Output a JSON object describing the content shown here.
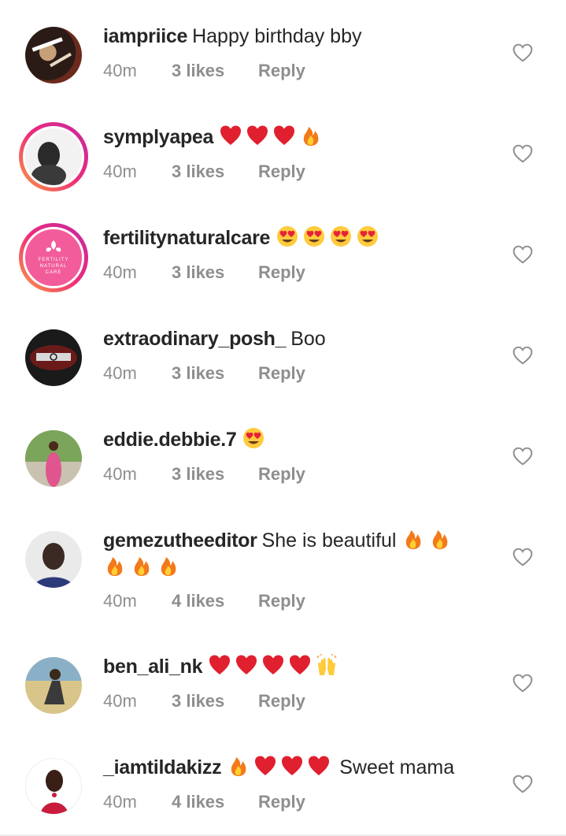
{
  "comments": [
    {
      "username": "iampriice",
      "text": "Happy birthday bby",
      "emojis": [],
      "time": "40m",
      "likes": "3 likes",
      "reply": "Reply",
      "story_ring": false,
      "avatar_colors": [
        "#6b2a1d",
        "#2b1b17",
        "#c7a07a"
      ]
    },
    {
      "username": "symplyapea",
      "text": "",
      "emojis": [
        "red-heart",
        "red-heart",
        "red-heart",
        "fire"
      ],
      "time": "40m",
      "likes": "3 likes",
      "reply": "Reply",
      "story_ring": true,
      "avatar_colors": [
        "#f2f2f2",
        "#2a2a2a",
        "#bdbdbd"
      ]
    },
    {
      "username": "fertilitynaturalcare",
      "text": "",
      "emojis": [
        "heart-eyes",
        "heart-eyes",
        "heart-eyes",
        "heart-eyes"
      ],
      "time": "40m",
      "likes": "3 likes",
      "reply": "Reply",
      "story_ring": true,
      "avatar_colors": [
        "#f25c9a",
        "#ffffff",
        "#f7a9c8"
      ],
      "avatar_logo_text": [
        "FERTILITY",
        "NATURAL",
        "CARE"
      ]
    },
    {
      "username": "extraodinary_posh_",
      "text": "Boo",
      "emojis": [],
      "time": "40m",
      "likes": "3 likes",
      "reply": "Reply",
      "story_ring": false,
      "avatar_colors": [
        "#1a1a1a",
        "#6b1a1a",
        "#d9d9d9"
      ]
    },
    {
      "username": "eddie.debbie.7",
      "text": "",
      "emojis": [
        "heart-eyes"
      ],
      "time": "40m",
      "likes": "3 likes",
      "reply": "Reply",
      "story_ring": false,
      "avatar_colors": [
        "#7ba55a",
        "#e0558d",
        "#c9c2b0"
      ]
    },
    {
      "username": "gemezutheeditor",
      "text": "She is beautiful",
      "emojis": [
        "fire",
        "fire"
      ],
      "emojis_line2": [
        "fire",
        "fire",
        "fire"
      ],
      "time": "40m",
      "likes": "4 likes",
      "reply": "Reply",
      "story_ring": false,
      "avatar_colors": [
        "#eaeaea",
        "#3b2a24",
        "#2d3a7a"
      ]
    },
    {
      "username": "ben_ali_nk",
      "text": "",
      "emojis": [
        "red-heart",
        "red-heart",
        "red-heart",
        "red-heart",
        "raising-hands"
      ],
      "time": "40m",
      "likes": "3 likes",
      "reply": "Reply",
      "story_ring": false,
      "avatar_colors": [
        "#d9c58a",
        "#3a3a3a",
        "#8ab0c7"
      ]
    },
    {
      "username": "_iamtildakizz",
      "text": "Sweet mama",
      "emojis": [
        "fire",
        "red-heart",
        "red-heart",
        "red-heart"
      ],
      "time": "40m",
      "likes": "4 likes",
      "reply": "Reply",
      "story_ring": false,
      "avatar_colors": [
        "#ffffff",
        "#3a1f16",
        "#c91c3d"
      ]
    }
  ],
  "colors": {
    "text": "#262626",
    "meta": "#8e8e8e",
    "heart_outline": "#8e8e8e",
    "ring_start": "#f9a03f",
    "ring_end": "#c32aa3"
  }
}
